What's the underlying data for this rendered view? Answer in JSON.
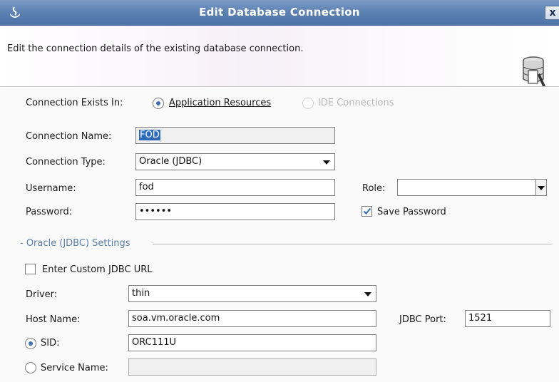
{
  "window": {
    "title": "Edit Database Connection",
    "close_label": "x"
  },
  "header": {
    "description": "Edit the connection details of the existing database connection."
  },
  "connection_exists_in": {
    "label": "Connection Exists In:",
    "options": [
      {
        "label": "Application Resources",
        "selected": true,
        "enabled": true
      },
      {
        "label": "IDE Connections",
        "selected": false,
        "enabled": false
      }
    ]
  },
  "form": {
    "connection_name": {
      "label": "Connection Name:",
      "value": "FOD"
    },
    "connection_type": {
      "label": "Connection Type:",
      "value": "Oracle (JDBC)"
    },
    "username": {
      "label": "Username:",
      "value": "fod"
    },
    "password": {
      "label": "Password:",
      "value": "••••••"
    },
    "role": {
      "label": "Role:",
      "value": ""
    },
    "save_password": {
      "label": "Save Password",
      "checked": true
    }
  },
  "oracle_settings": {
    "section_title": "- Oracle (JDBC) Settings",
    "custom_url": {
      "label": "Enter Custom JDBC URL",
      "checked": false
    },
    "driver": {
      "label": "Driver:",
      "value": "thin"
    },
    "host_name": {
      "label": "Host Name:",
      "value": "soa.vm.oracle.com"
    },
    "jdbc_port": {
      "label": "JDBC Port:",
      "value": "1521"
    },
    "sid": {
      "label": "SID:",
      "value": "ORC111U",
      "selected": true
    },
    "service_name": {
      "label": "Service Name:",
      "value": "",
      "selected": false
    }
  },
  "icons": {
    "title_icon": "oracle-jdeveloper-icon",
    "header_icon": "database-edit-icon",
    "checkbox_mark": "check-icon"
  },
  "colors": {
    "title_bar": "#5d82b3",
    "selection": "#2f6bbd",
    "section_title": "#5b7fa9",
    "radio_dot": "#3f6fb0"
  }
}
